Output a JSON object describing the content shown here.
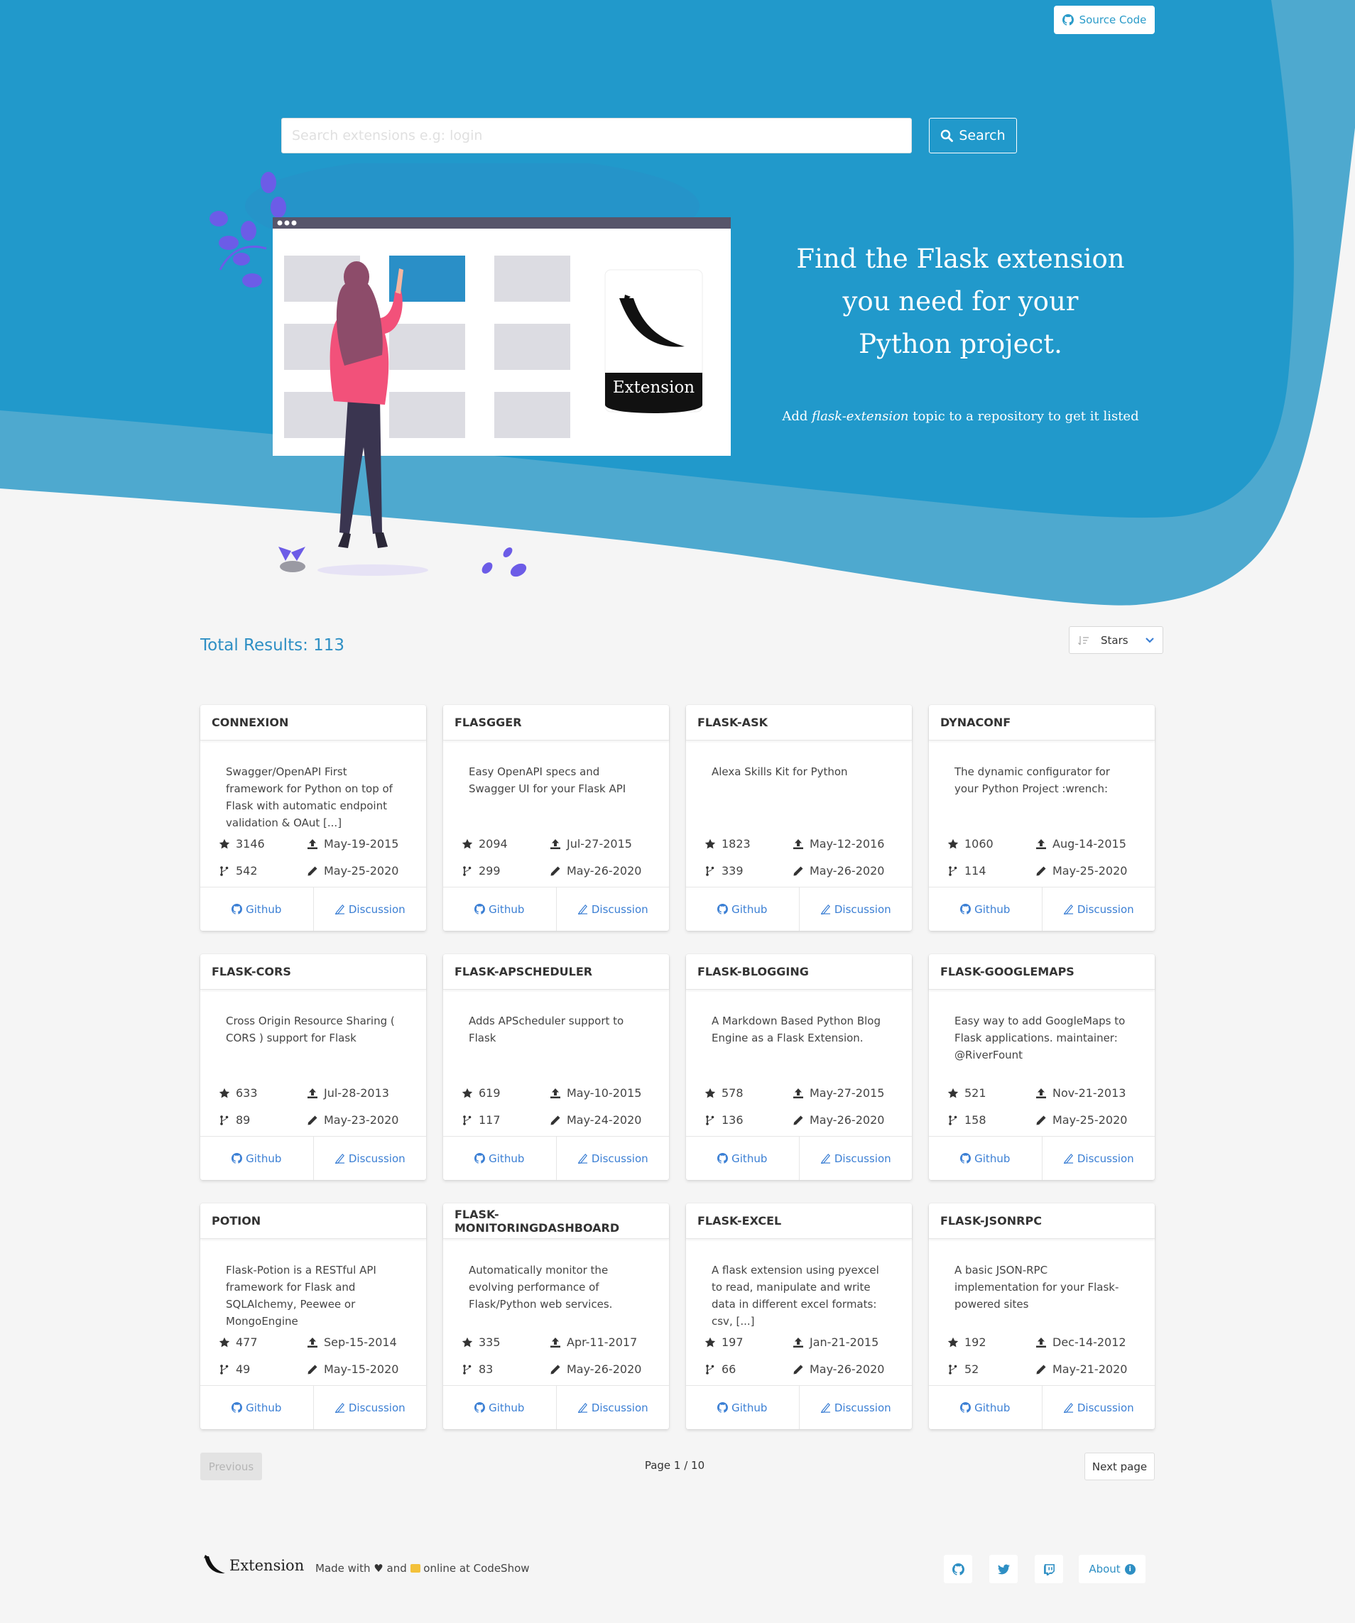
{
  "colors": {
    "hero_primary": "#2199cb",
    "hero_secondary": "#4ea9cf",
    "accent": "#2e8fc4",
    "link": "#3b7fd4"
  },
  "header": {
    "source_code_label": "Source Code",
    "source_code_icon": "github-icon"
  },
  "search": {
    "placeholder": "Search extensions e.g: login",
    "button_label": "Search",
    "button_icon": "search-icon"
  },
  "hero": {
    "tagline_lines": [
      "Find the Flask extension",
      "you need for your",
      "Python project."
    ],
    "sub_before": "Add ",
    "sub_em": "flask-extension",
    "sub_after": " topic to a repository to get it listed",
    "badge_label": "Extension"
  },
  "results": {
    "total_label": "Total Results: 113",
    "sort_label": "Stars",
    "sort_icon": "sort-icon"
  },
  "card_links": {
    "github": "Github",
    "discussion": "Discussion"
  },
  "extensions": [
    {
      "name": "CONNEXION",
      "description": "Swagger/OpenAPI First framework for Python on top of Flask with automatic endpoint validation & OAut [...]",
      "stars": "3146",
      "created": "May-19-2015",
      "forks": "542",
      "updated": "May-25-2020"
    },
    {
      "name": "FLASGGER",
      "description": "Easy OpenAPI specs and Swagger UI for your Flask API",
      "stars": "2094",
      "created": "Jul-27-2015",
      "forks": "299",
      "updated": "May-26-2020"
    },
    {
      "name": "FLASK-ASK",
      "description": "Alexa Skills Kit for Python",
      "stars": "1823",
      "created": "May-12-2016",
      "forks": "339",
      "updated": "May-26-2020"
    },
    {
      "name": "DYNACONF",
      "description": "The dynamic configurator for your Python Project :wrench:",
      "stars": "1060",
      "created": "Aug-14-2015",
      "forks": "114",
      "updated": "May-25-2020"
    },
    {
      "name": "FLASK-CORS",
      "description": "Cross Origin Resource Sharing ( CORS ) support for Flask",
      "stars": "633",
      "created": "Jul-28-2013",
      "forks": "89",
      "updated": "May-23-2020"
    },
    {
      "name": "FLASK-APSCHEDULER",
      "description": "Adds APScheduler support to Flask",
      "stars": "619",
      "created": "May-10-2015",
      "forks": "117",
      "updated": "May-24-2020"
    },
    {
      "name": "FLASK-BLOGGING",
      "description": "A Markdown Based Python Blog Engine as a Flask Extension.",
      "stars": "578",
      "created": "May-27-2015",
      "forks": "136",
      "updated": "May-26-2020"
    },
    {
      "name": "FLASK-GOOGLEMAPS",
      "description": "Easy way to add GoogleMaps to Flask applications. maintainer: @RiverFount",
      "stars": "521",
      "created": "Nov-21-2013",
      "forks": "158",
      "updated": "May-25-2020"
    },
    {
      "name": "POTION",
      "description": "Flask-Potion is a RESTful API framework for Flask and SQLAlchemy, Peewee or MongoEngine",
      "stars": "477",
      "created": "Sep-15-2014",
      "forks": "49",
      "updated": "May-15-2020"
    },
    {
      "name": "FLASK-MONITORINGDASHBOARD",
      "description": "Automatically monitor the evolving performance of Flask/Python web services.",
      "stars": "335",
      "created": "Apr-11-2017",
      "forks": "83",
      "updated": "May-26-2020"
    },
    {
      "name": "FLASK-EXCEL",
      "description": "A flask extension using pyexcel to read, manipulate and write data in different excel formats: csv, [...]",
      "stars": "197",
      "created": "Jan-21-2015",
      "forks": "66",
      "updated": "May-26-2020"
    },
    {
      "name": "FLASK-JSONRPC",
      "description": "A basic JSON-RPC implementation for your Flask-powered sites",
      "stars": "192",
      "created": "Dec-14-2012",
      "forks": "52",
      "updated": "May-21-2020"
    }
  ],
  "pagination": {
    "previous_label": "Previous",
    "page_label": "Page 1 / 10",
    "next_label": "Next page"
  },
  "footer": {
    "logo_text": "Extension",
    "made_with": "Made with",
    "and": "and",
    "online_at": "online at CodeShow",
    "about_label": "About",
    "social_icons": [
      "github-icon",
      "twitter-icon",
      "twitch-icon"
    ]
  }
}
